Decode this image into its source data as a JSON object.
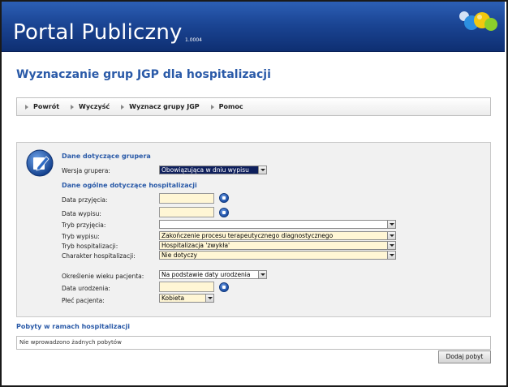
{
  "header": {
    "brand": "Portal Publiczny",
    "version": "1.0004"
  },
  "page": {
    "title": "Wyznaczanie grup JGP dla hospitalizacji"
  },
  "toolbar": {
    "items": [
      "Powrót",
      "Wyczyść",
      "Wyznacz grupy JGP",
      "Pomoc"
    ]
  },
  "form": {
    "grouper_section": "Dane dotyczące grupera",
    "grouper_version_label": "Wersja grupera:",
    "grouper_version_value": "Obowiązująca w dniu wypisu",
    "general_section": "Dane ogólne dotyczące hospitalizacji",
    "admission_date_label": "Data przyjęcia:",
    "discharge_date_label": "Data wypisu:",
    "admission_mode_label": "Tryb przyjęcia:",
    "admission_mode_value": "",
    "discharge_mode_label": "Tryb wypisu:",
    "discharge_mode_value": "Zakończenie procesu terapeutycznego diagnostycznego",
    "hospitalization_mode_label": "Tryb hospitalizacji:",
    "hospitalization_mode_value": "Hospitalizacja 'zwykła'",
    "hospitalization_char_label": "Charakter hospitalizacji:",
    "hospitalization_char_value": "Nie dotyczy",
    "age_method_label": "Określenie wieku pacjenta:",
    "age_method_value": "Na podstawie daty urodzenia",
    "birth_date_label": "Data urodzenia:",
    "sex_label": "Płeć pacjenta:",
    "sex_value": "Kobieta"
  },
  "stays": {
    "title": "Pobyty w ramach hospitalizacji",
    "empty_text": "Nie wprowadzono żadnych pobytów",
    "add_button": "Dodaj pobyt"
  },
  "colors": {
    "header_blue": "#1b4594",
    "title_blue": "#2a5aa8",
    "input_yellow": "#fff6d5",
    "selected_select": "#0e1f5c"
  }
}
